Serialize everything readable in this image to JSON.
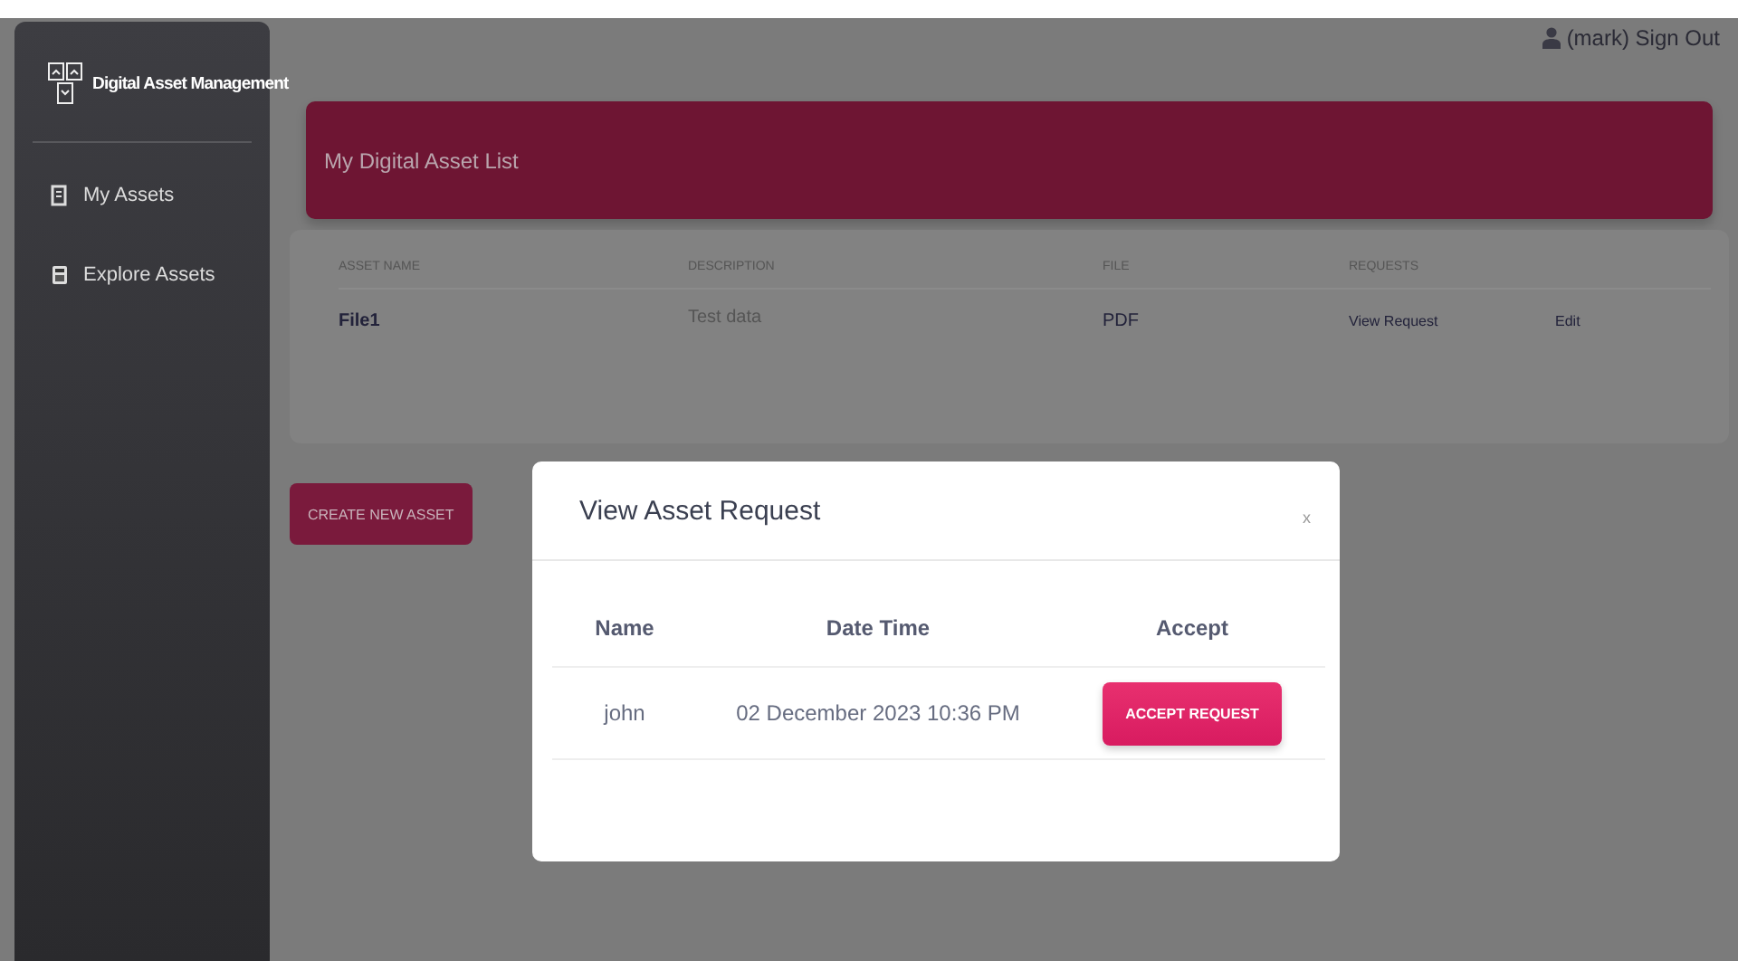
{
  "sidebar": {
    "title": "Digital Asset Management",
    "items": [
      {
        "label": "My Assets",
        "kind": "document"
      },
      {
        "label": "Explore Assets",
        "kind": "calculator"
      }
    ]
  },
  "user_link": "(mark) Sign Out",
  "asset_list": {
    "title": "My Digital Asset List",
    "columns": [
      "ASSET NAME",
      "DESCRIPTION",
      "FILE",
      "REQUESTS"
    ],
    "rows": [
      {
        "asset_name": "File1",
        "description": "Test data",
        "file": "PDF",
        "requests": "View Request",
        "action": "Edit"
      }
    ]
  },
  "create_button": "CREATE NEW ASSET",
  "modal": {
    "title": "View Asset Request",
    "close": "x",
    "columns": [
      "Name",
      "Date Time",
      "Accept"
    ],
    "rows": [
      {
        "name": "john",
        "date_time": "02 December 2023 10:36 PM",
        "button": "ACCEPT REQUEST"
      }
    ]
  }
}
